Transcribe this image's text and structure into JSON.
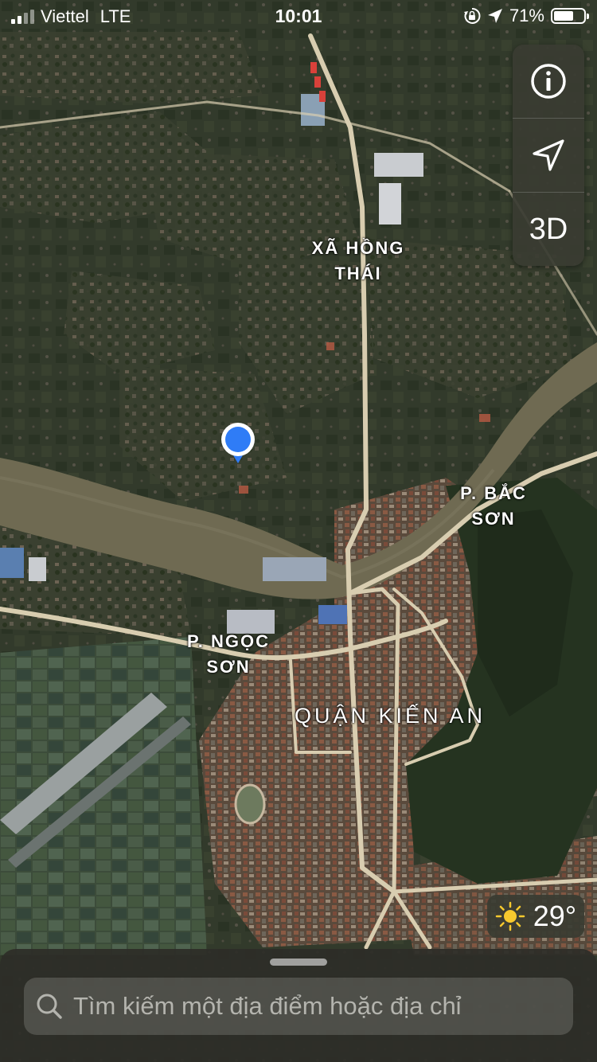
{
  "status_bar": {
    "carrier": "Viettel",
    "network": "LTE",
    "time": "10:01",
    "battery_percent": "71%",
    "battery_level": 0.71,
    "signal_bars_filled": 2,
    "signal_bars_total": 4,
    "icons": [
      "orientation-lock-icon",
      "location-arrow-icon",
      "battery-icon"
    ]
  },
  "map": {
    "type": "satellite",
    "labels": {
      "hong_thai_line1": "XÃ HỒNG",
      "hong_thai_line2": "THÁI",
      "bac_son_line1": "P. BẮC",
      "bac_son_line2": "SƠN",
      "ngoc_son_line1": "P. NGỌC",
      "ngoc_son_line2": "SƠN",
      "kien_an": "QUẬN KIẾN AN"
    }
  },
  "controls": {
    "info_icon": "info-icon",
    "location_icon": "location-arrow-icon",
    "three_d_label": "3D"
  },
  "weather": {
    "icon": "sun-icon",
    "temperature": "29°"
  },
  "search": {
    "placeholder": "Tìm kiếm một địa điểm hoặc địa chỉ"
  },
  "colors": {
    "pin_blue": "#2f7cf6",
    "road": "#d8cdb0",
    "river": "#6f6a52",
    "sun": "#f7c92e"
  }
}
